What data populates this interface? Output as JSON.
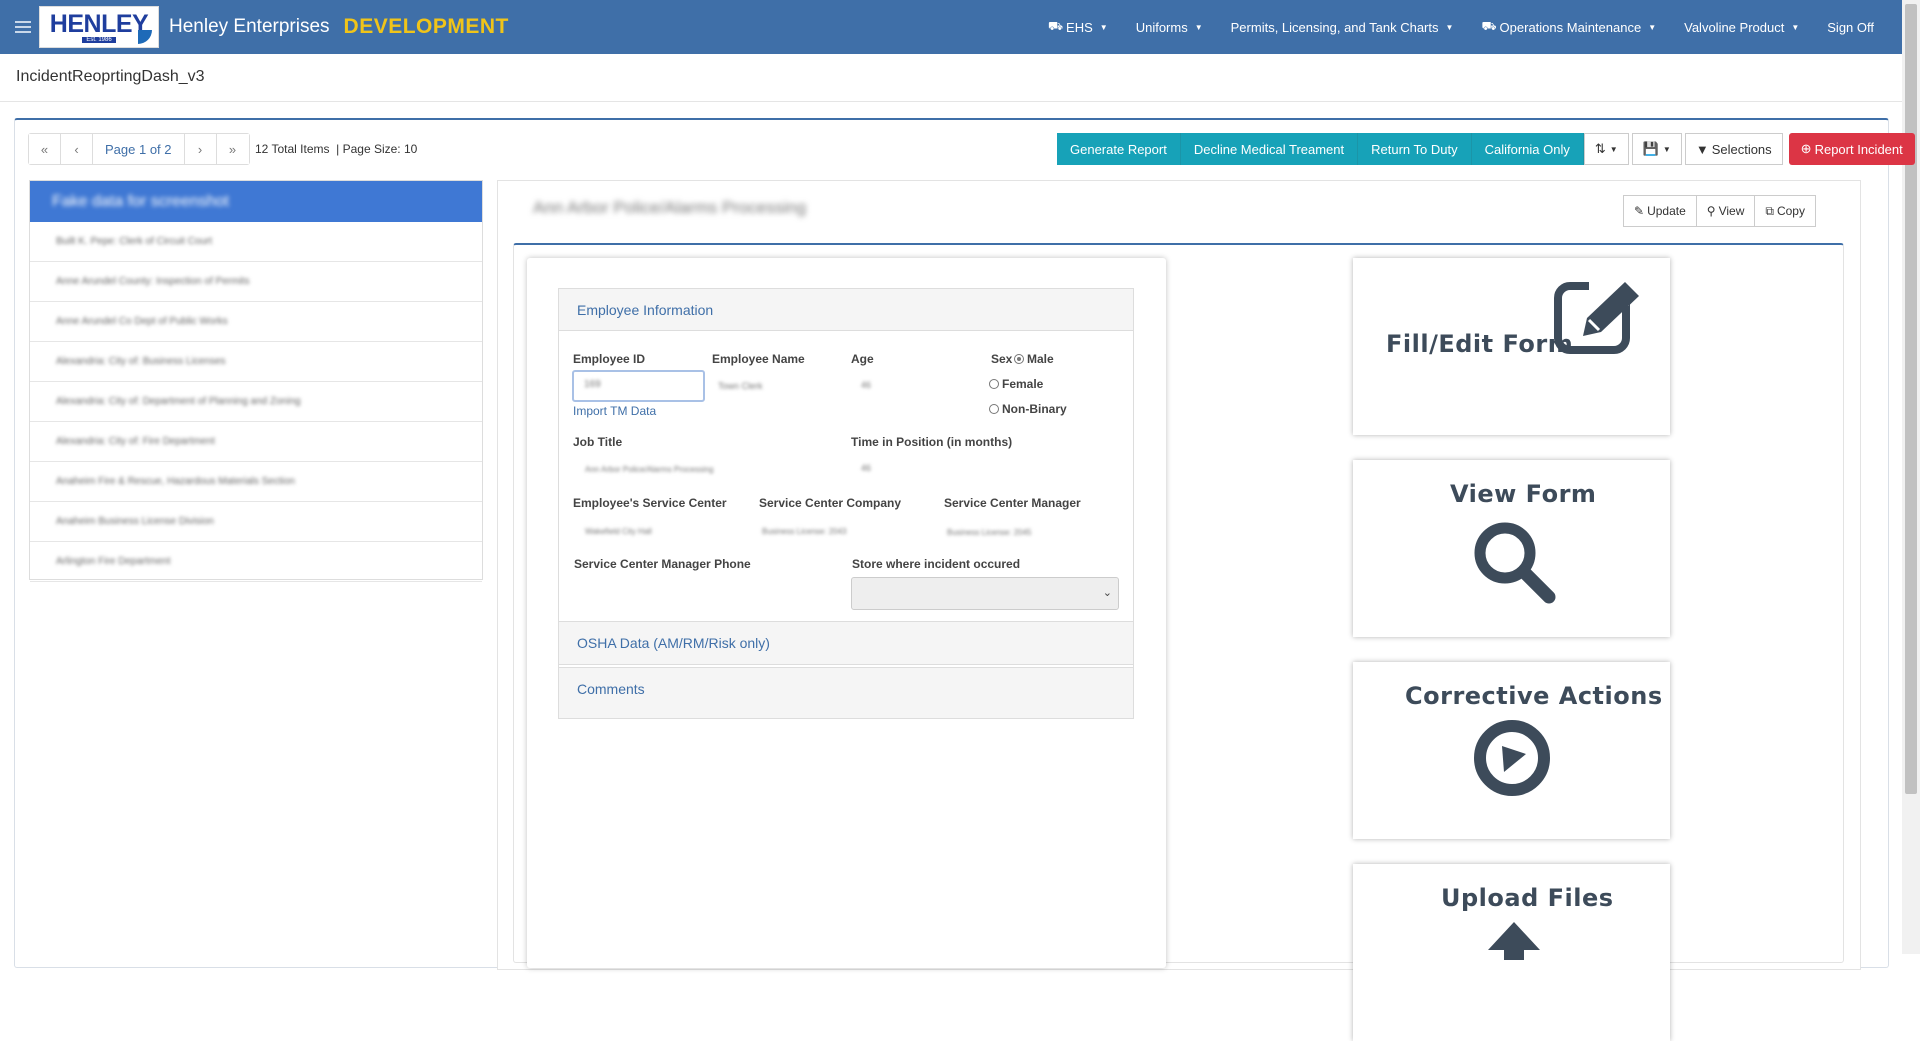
{
  "navbar": {
    "logo_text": "HENLEY",
    "logo_sub": "Est. 1986",
    "brand": "Henley Enterprises",
    "environment": "DEVELOPMENT",
    "menu": [
      {
        "label": "EHS",
        "icon": "truck-icon"
      },
      {
        "label": "Uniforms",
        "icon": ""
      },
      {
        "label": "Permits, Licensing, and Tank Charts",
        "icon": ""
      },
      {
        "label": "Operations Maintenance",
        "icon": "car-icon"
      },
      {
        "label": "Valvoline Product",
        "icon": ""
      },
      {
        "label": "Sign Off",
        "icon": ""
      }
    ]
  },
  "page": {
    "title": "IncidentReoprtingDash_v3"
  },
  "pager": {
    "first": "«",
    "prev": "‹",
    "page": "Page 1 of 2",
    "next": "›",
    "last": "»",
    "info": "12 Total Items  | Page Size: 10"
  },
  "actions": {
    "generate_report": "Generate Report",
    "decline_medical": "Decline Medical Treament",
    "return_to_duty": "Return To Duty",
    "california_only": "California Only",
    "selections": "Selections",
    "report_incident": "Report Incident"
  },
  "list": {
    "header": "Fake data for screenshot",
    "items": [
      "Built K. Pepe: Clerk of Circuit Court",
      "Anne Arundel County: Inspection of Permits",
      "Anne Arundel Co Dept of Public Works",
      "Alexandria: City of: Business Licenses",
      "Alexandria: City of: Department of Planning and Zoning",
      "Alexandria: City of: Fire Department",
      "Anaheim Fire & Rescue, Hazardous Materials Section",
      "Anaheim Business License Division",
      "Arlington Fire Department"
    ]
  },
  "detail": {
    "title": "Ann Arbor Police/Alarms Processing",
    "update": "Update",
    "view": "View",
    "copy": "Copy"
  },
  "form": {
    "section_employee": "Employee Information",
    "section_osha": "OSHA Data (AM/RM/Risk only)",
    "section_comments": "Comments",
    "employee_id_label": "Employee ID",
    "employee_id_value": "169",
    "import_link": "Import TM Data",
    "employee_name_label": "Employee Name",
    "employee_name_value": "Town Clerk",
    "age_label": "Age",
    "age_value": "46",
    "sex_label": "Sex",
    "sex_options": [
      "Male",
      "Female",
      "Non-Binary"
    ],
    "job_title_label": "Job Title",
    "job_title_value": "Ann Arbor Police/Alarms Processing",
    "time_in_position_label": "Time in Position (in months)",
    "time_in_position_value": "46",
    "service_center_label": "Employee's Service Center",
    "service_center_value": "Wakefield City Hall",
    "sc_company_label": "Service Center Company",
    "sc_company_value": "Business License: 2043",
    "sc_manager_label": "Service Center Manager",
    "sc_manager_value": "Business License: 2045",
    "sc_manager_phone_label": "Service Center Manager Phone",
    "store_label": "Store where incident occured",
    "store_value": ""
  },
  "tiles": {
    "fill_edit": "Fill/Edit Form",
    "view_form": "View Form",
    "corrective": "Corrective Actions",
    "upload": "Upload Files"
  },
  "colors": {
    "navbar": "#3f6fa8",
    "environment": "#f0c419",
    "teal": "#17a2b8",
    "danger": "#dc3545",
    "list_header": "#3f78d4",
    "tile_icon": "#3d4b5a"
  }
}
